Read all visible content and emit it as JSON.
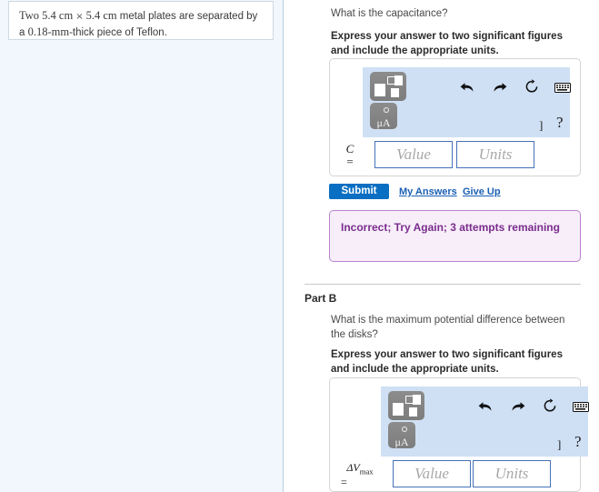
{
  "left_panel": {
    "problem_statement_prefix": "Two 5.4 cm",
    "times_symbol": "×",
    "problem_statement_mid": "5.4 cm",
    "problem_statement_tail": " metal plates are separated by a ",
    "thickness": "0.18-mm",
    "problem_statement_end": "-thick piece of Teflon."
  },
  "part_a": {
    "question": "What is the capacitance?",
    "instruction": "Express your answer to two significant figures and include the appropriate units.",
    "variable_symbol": "C",
    "equals": "=",
    "value_placeholder": "Value",
    "units_placeholder": "Units",
    "value_current": "",
    "units_current": "",
    "submit_label": "Submit",
    "my_answers_label": "My Answers",
    "give_up_label": "Give Up",
    "feedback": "Incorrect; Try Again; 3 attempts remaining",
    "toolbar": {
      "template_icon": "math-template-icon",
      "units_icon_label": "μA",
      "undo_icon": "undo-arrow-icon",
      "redo_icon": "redo-arrow-icon",
      "reset_icon": "reset-circular-arrow-icon",
      "keyboard_icon": "keyboard-icon",
      "bracket_symbol": "]",
      "help_symbol": "?"
    }
  },
  "part_b": {
    "title": "Part B",
    "question": "What is the maximum potential difference between the disks?",
    "instruction": "Express your answer to two significant figures and include the appropriate units.",
    "variable_symbol": "ΔV",
    "variable_subscript": "max",
    "equals": "=",
    "value_placeholder": "Value",
    "units_placeholder": "Units",
    "value_current": "",
    "units_current": "",
    "toolbar": {
      "template_icon": "math-template-icon",
      "units_icon_label": "μA",
      "undo_icon": "undo-arrow-icon",
      "redo_icon": "redo-arrow-icon",
      "reset_icon": "reset-circular-arrow-icon",
      "keyboard_icon": "keyboard-icon",
      "bracket_symbol": "]",
      "help_symbol": "?"
    }
  },
  "colors": {
    "left_panel_bg": "#f2f7fd",
    "toolbar_bg": "#cfe0f5",
    "submit_blue": "#0a6fc2",
    "link_blue": "#1a5fb4",
    "feedback_bg": "#f7eefa",
    "feedback_border": "#b982cc",
    "feedback_text": "#7a2d8c",
    "field_border": "#4472b8"
  }
}
